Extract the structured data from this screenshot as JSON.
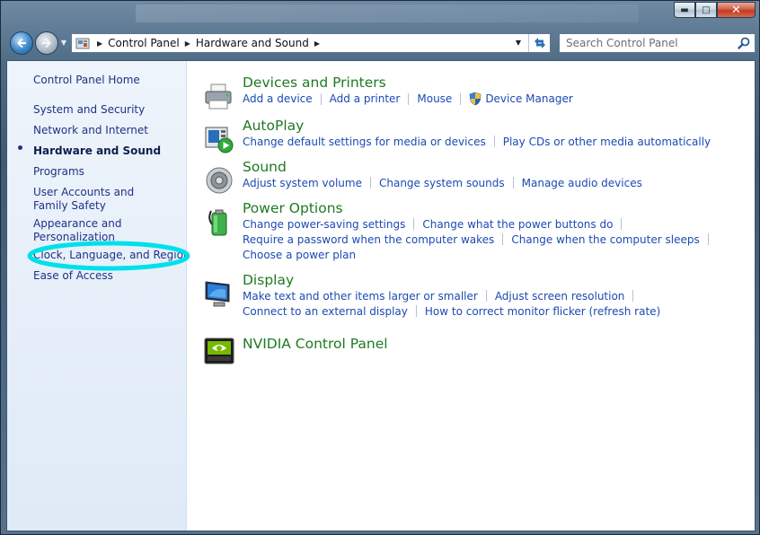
{
  "window": {
    "caption_buttons": {
      "minimize": "▬",
      "maximize": "□",
      "close": "✕"
    }
  },
  "nav": {
    "back_icon": "back-arrow-icon",
    "forward_icon": "forward-arrow-icon",
    "breadcrumbs": [
      "Control Panel",
      "Hardware and Sound"
    ],
    "search_placeholder": "Search Control Panel"
  },
  "sidebar": {
    "items": [
      {
        "label": "Control Panel Home"
      },
      {
        "label": "System and Security"
      },
      {
        "label": "Network and Internet"
      },
      {
        "label": "Hardware and Sound",
        "current": true
      },
      {
        "label": "Programs"
      },
      {
        "label": "User Accounts and Family Safety"
      },
      {
        "label": "Appearance and Personalization"
      },
      {
        "label": "Clock, Language, and Region",
        "highlighted": true
      },
      {
        "label": "Ease of Access"
      }
    ],
    "highlight_color": "#00e0ea"
  },
  "categories": [
    {
      "title": "Devices and Printers",
      "icon": "printer-icon",
      "rows": [
        [
          "Add a device",
          "Add a printer",
          "Mouse",
          "Device Manager"
        ]
      ]
    },
    {
      "title": "AutoPlay",
      "icon": "autoplay-icon",
      "rows": [
        [
          "Change default settings for media or devices",
          "Play CDs or other media automatically"
        ]
      ]
    },
    {
      "title": "Sound",
      "icon": "speaker-icon",
      "rows": [
        [
          "Adjust system volume",
          "Change system sounds",
          "Manage audio devices"
        ]
      ]
    },
    {
      "title": "Power Options",
      "icon": "battery-icon",
      "rows": [
        [
          "Change power-saving settings",
          "Change what the power buttons do"
        ],
        [
          "Require a password when the computer wakes",
          "Change when the computer sleeps"
        ],
        [
          "Choose a power plan"
        ]
      ]
    },
    {
      "title": "Display",
      "icon": "monitor-icon",
      "rows": [
        [
          "Make text and other items larger or smaller",
          "Adjust screen resolution"
        ],
        [
          "Connect to an external display",
          "How to correct monitor flicker (refresh rate)"
        ]
      ]
    },
    {
      "title": "NVIDIA Control Panel",
      "icon": "nvidia-icon",
      "rows": []
    }
  ],
  "colors": {
    "category_title": "#1e7a23",
    "task_link": "#1b4ab3",
    "sidebar_link": "#1e3287"
  }
}
